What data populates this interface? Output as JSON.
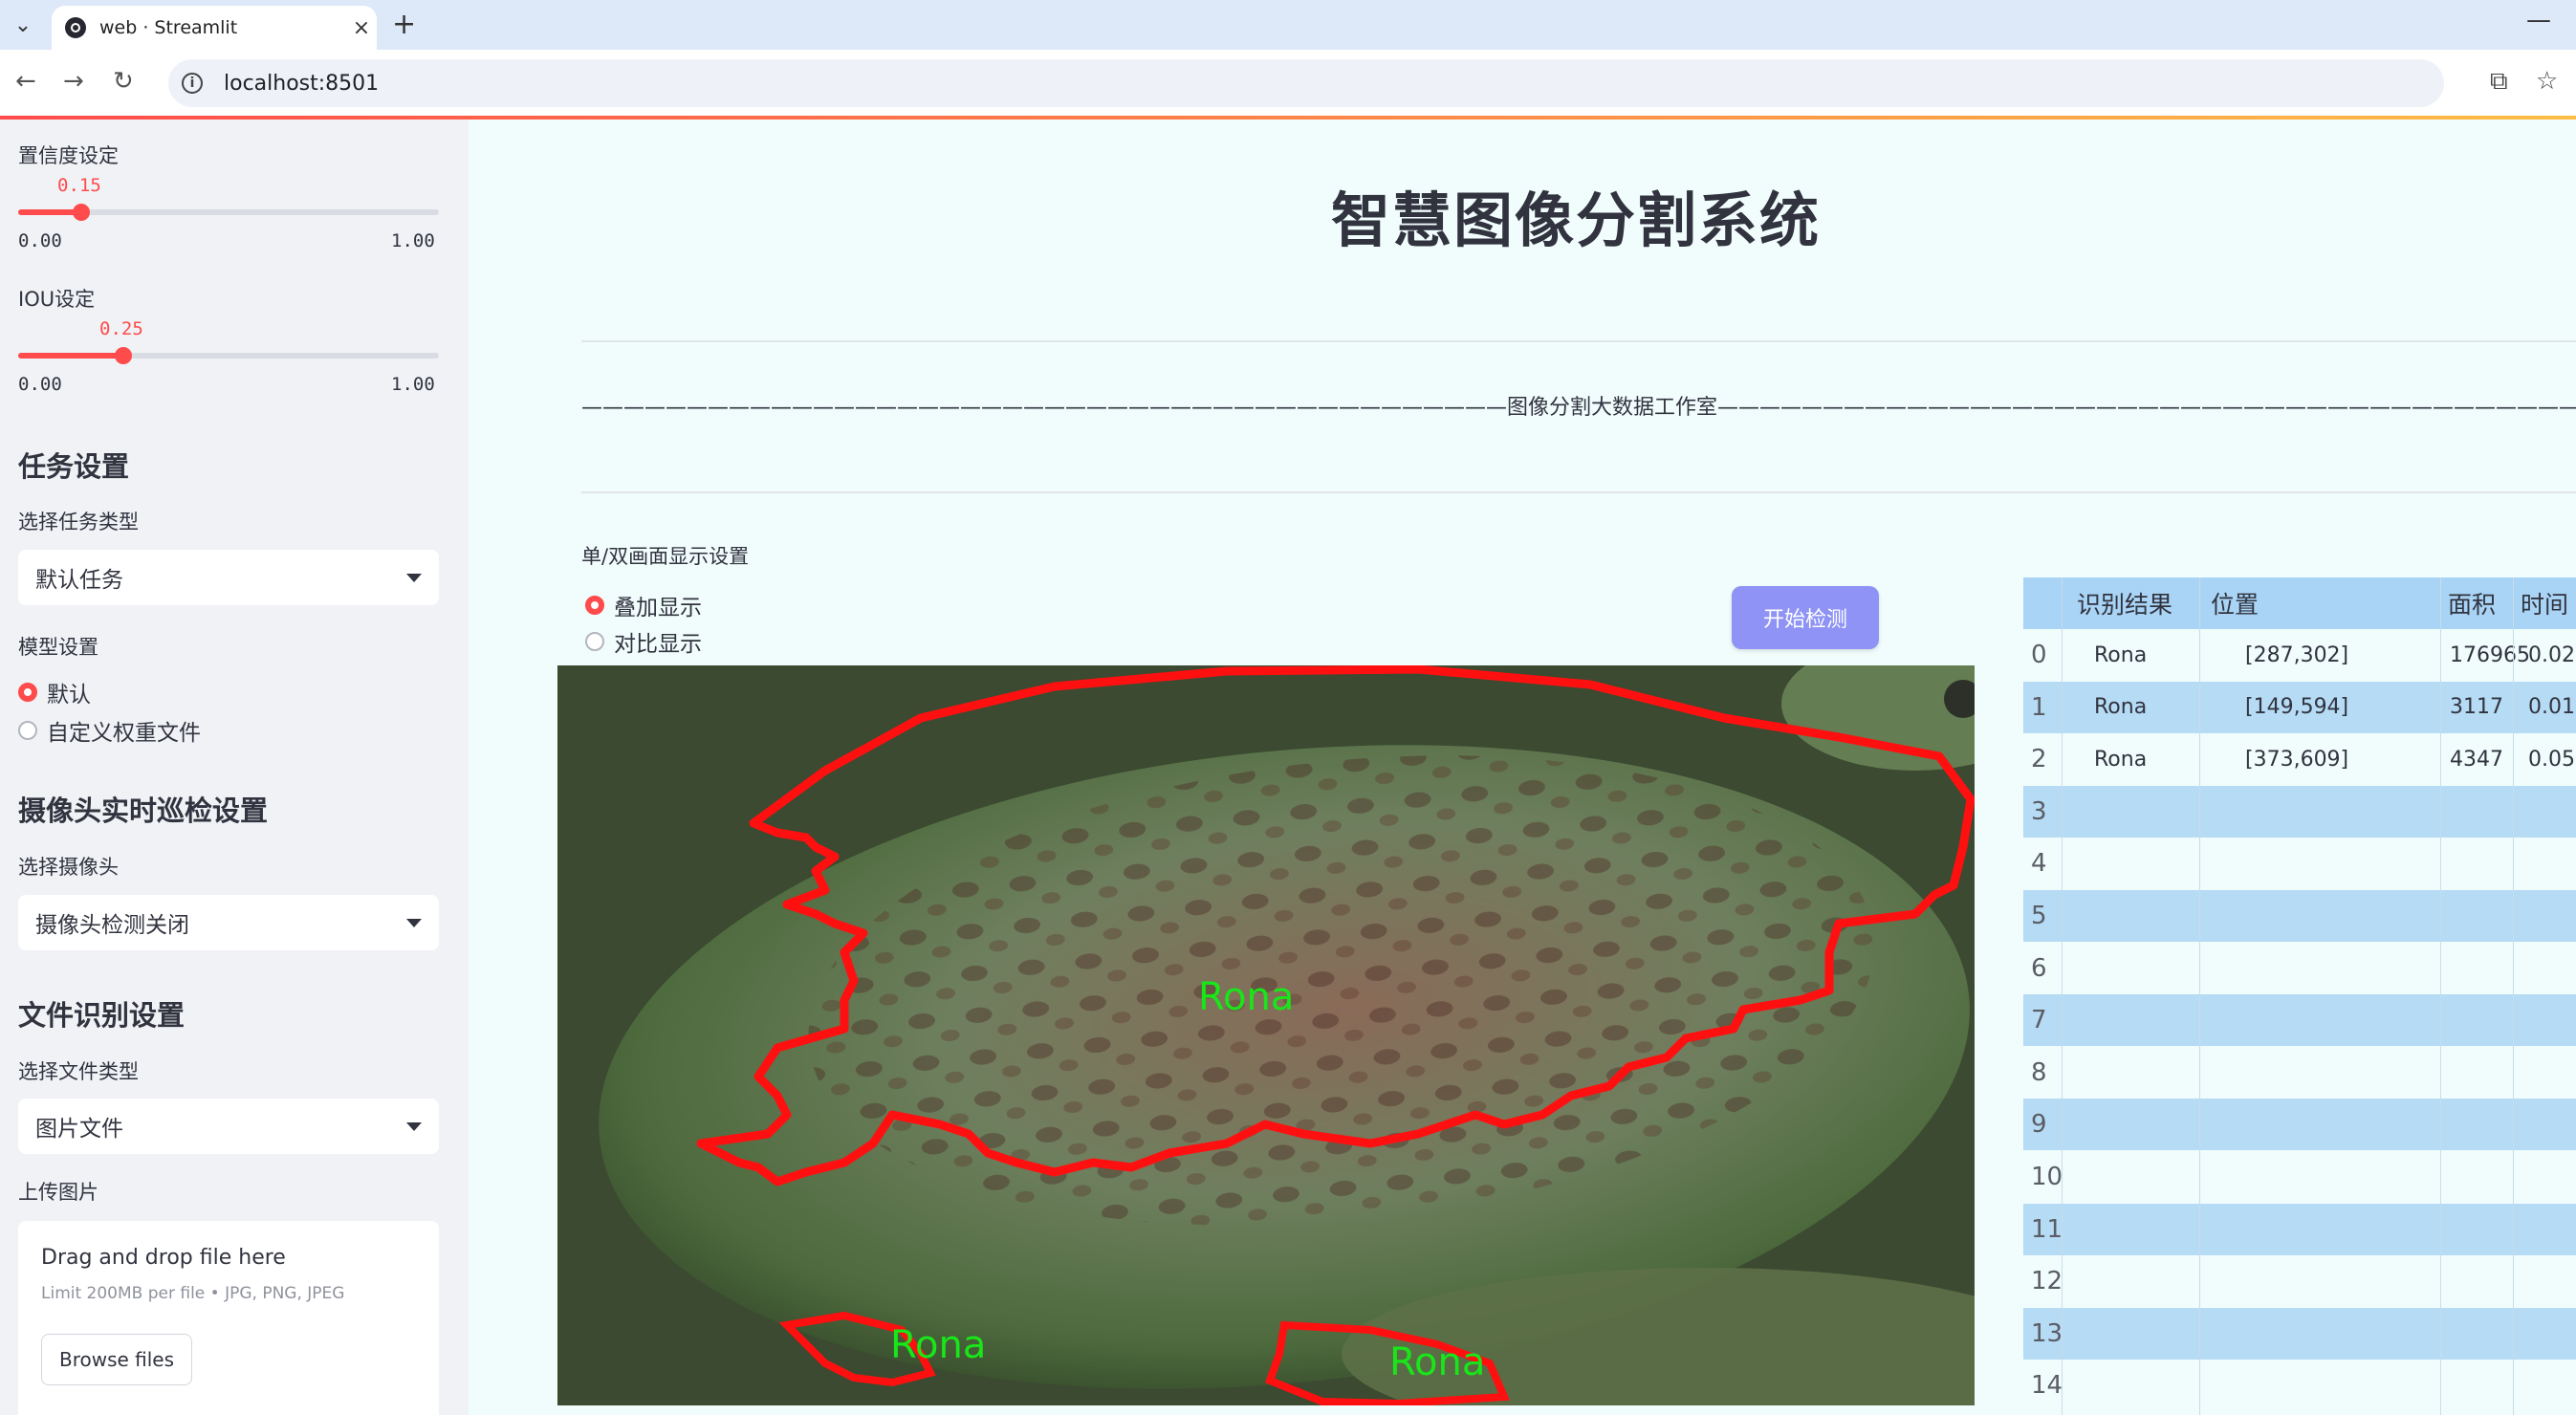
{
  "browser": {
    "tab_title": "web · Streamlit",
    "url": "localhost:8501"
  },
  "sidebar": {
    "confidence": {
      "label": "置信度设定",
      "value": "0.15",
      "min": "0.00",
      "max": "1.00",
      "level": 0.15
    },
    "iou": {
      "label": "IOU设定",
      "value": "0.25",
      "min": "0.00",
      "max": "1.00",
      "level": 0.25
    },
    "task": {
      "heading": "任务设置",
      "select_label": "选择任务类型",
      "selected": "默认任务"
    },
    "model": {
      "label": "模型设置",
      "options": [
        "默认",
        "自定义权重文件"
      ],
      "selected_index": 0
    },
    "camera": {
      "heading": "摄像头实时巡检设置",
      "select_label": "选择摄像头",
      "selected": "摄像头检测关闭"
    },
    "file": {
      "heading": "文件识别设置",
      "select_label": "选择文件类型",
      "selected": "图片文件"
    },
    "upload": {
      "label": "上传图片",
      "drop_text": "Drag and drop file here",
      "limit_text": "Limit 200MB per file • JPG, PNG, JPEG",
      "browse_label": "Browse files"
    }
  },
  "main": {
    "title": "智慧图像分割系统",
    "studio_banner": "————————————————————————————————————————————图像分割大数据工作室————————————————————————————————————————————",
    "display_mode": {
      "label": "单/双画面显示设置",
      "options": [
        "叠加显示",
        "对比显示"
      ],
      "selected_index": 0
    },
    "detect_button": "开始检测",
    "detections": [
      {
        "label": "Rona"
      },
      {
        "label": "Rona"
      },
      {
        "label": "Rona"
      }
    ]
  },
  "results_table": {
    "columns": [
      "识别结果",
      "位置",
      "面积",
      "时间"
    ],
    "rows": [
      {
        "index": "0",
        "result": "Rona",
        "position": "[287,302]",
        "area": "176965",
        "time": "0.02"
      },
      {
        "index": "1",
        "result": "Rona",
        "position": "[149,594]",
        "area": "3117",
        "time": "0.01"
      },
      {
        "index": "2",
        "result": "Rona",
        "position": "[373,609]",
        "area": "4347",
        "time": "0.05"
      },
      {
        "index": "3"
      },
      {
        "index": "4"
      },
      {
        "index": "5"
      },
      {
        "index": "6"
      },
      {
        "index": "7"
      },
      {
        "index": "8"
      },
      {
        "index": "9"
      },
      {
        "index": "10"
      },
      {
        "index": "11"
      },
      {
        "index": "12"
      },
      {
        "index": "13"
      },
      {
        "index": "14"
      }
    ]
  },
  "colors": {
    "accent": "#ff4b4b",
    "detect_button": "#8e93f5",
    "mask_outline": "#ff1010",
    "mask_label": "#19e619",
    "table_header": "#a9d4f5",
    "table_stripe": "#b6dbf5"
  }
}
